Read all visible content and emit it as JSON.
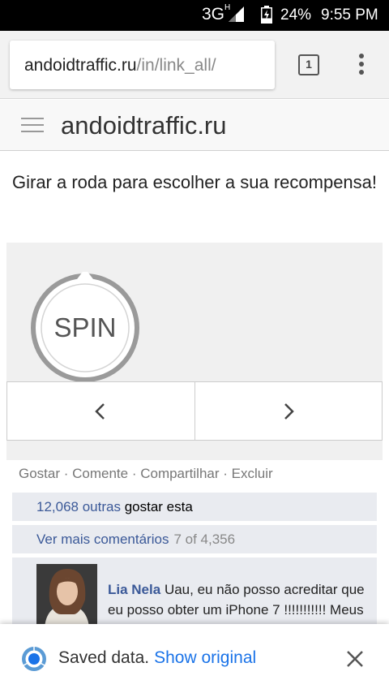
{
  "status_bar": {
    "network": "3G",
    "network_sub": "H",
    "battery": "24%",
    "time": "9:55 PM"
  },
  "browser": {
    "url_domain": "andoidtraffic.ru",
    "url_path": "/in/link_all/",
    "tab_count": "1"
  },
  "site": {
    "title": "andoidtraffic.ru"
  },
  "main": {
    "prompt": "Girar a roda para escolher a sua recompensa!",
    "spin_label": "SPIN"
  },
  "social": {
    "actions": "Gostar · Comente · Compartilhar · Excluir",
    "likes_count": "12,068 outras",
    "likes_suffix": "gostar esta",
    "more_comments": "Ver mais comentários",
    "more_count": "7 of 4,356",
    "comment_author": "Lia Nela",
    "comment_text": "Uau, eu não posso acreditar que eu posso obter um iPhone 7 !!!!!!!!!!! Meus amigos vão abersação!"
  },
  "snackbar": {
    "message": "Saved data.",
    "action": "Show original"
  },
  "colors": {
    "link_blue": "#3b5998",
    "snack_link": "#1a73e8",
    "comment_bg": "#e9ebf0"
  }
}
